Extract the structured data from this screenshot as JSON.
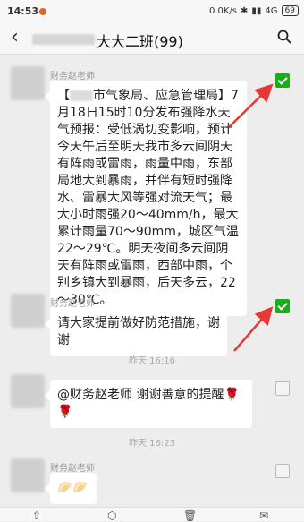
{
  "status": {
    "time": "14:53",
    "network_speed": "0.0K/s",
    "network_type": "4G",
    "battery": "69"
  },
  "nav": {
    "title": "大大二班(99)"
  },
  "messages": [
    {
      "sender": "财务赵老师",
      "text_prefix": "【",
      "text_body": "市气象局、应急管理局】7月18日15时10分发布强降水天气预报：受低涡切变影响，预计今天午后至明天我市多云间阴天有阵雨或雷雨，雨量中雨，东部局地大到暴雨，并伴有短时强降水、雷暴大风等强对流天气；最大小时雨强20～40mm/h，最大累计雨量70～90mm，城区气温22～29℃。明天夜间多云间阴天有阵雨或雷雨，西部中雨，个别乡镇大到暴雨，后天多云，22～30℃。",
      "selected": true
    },
    {
      "sender": "财务赵老师",
      "text": "请大家提前做好防范措施，谢谢",
      "selected": true
    },
    {
      "time_label": "昨天 16:16"
    },
    {
      "text": "@财务赵老师  谢谢善意的提醒🌹🌹",
      "selected": false
    },
    {
      "time_label": "昨天 16:23"
    },
    {
      "sender": "财务赵老师",
      "text": "🥟🥟",
      "selected": false
    }
  ],
  "toolbar": {
    "icons": [
      "share-icon",
      "favorite-icon",
      "delete-icon",
      "mail-icon"
    ]
  },
  "colors": {
    "check_green": "#1aad19",
    "annotation_red": "#e53935"
  }
}
